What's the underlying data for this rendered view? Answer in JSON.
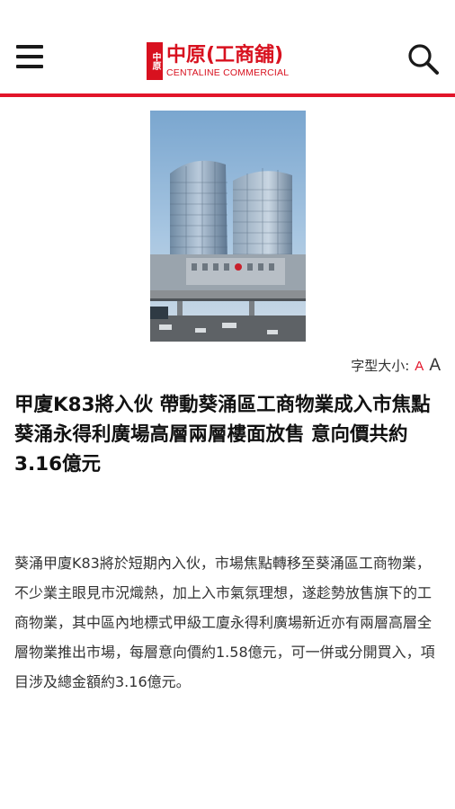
{
  "header": {
    "logo_cn": "中原(工商舖)",
    "logo_en": "CENTALINE COMMERCIAL",
    "logo_seal": "中原",
    "menu_icon": "hamburger-menu-icon",
    "search_icon": "search-icon",
    "accent_color": "#e2152a"
  },
  "article": {
    "image_description_icon": "building-photo",
    "font_size_label": "字型大小:",
    "font_small_label": "A",
    "font_large_label": "A",
    "title": "甲廈K83將入伙 帶動葵涌區工商物業成入市焦點 葵涌永得利廣場高層兩層樓面放售 意向價共約3.16億元",
    "body": "葵涌甲廈K83將於短期內入伙，市場焦點轉移至葵涌區工商物業，不少業主眼見市況熾熱，加上入市氣氛理想，遂趁勢放售旗下的工商物業，其中區內地標式甲級工廈永得利廣場新近亦有兩層高層全層物業推出市場，每層意向價約1.58億元，可一併或分開買入，項目涉及總金額約3.16億元。"
  }
}
